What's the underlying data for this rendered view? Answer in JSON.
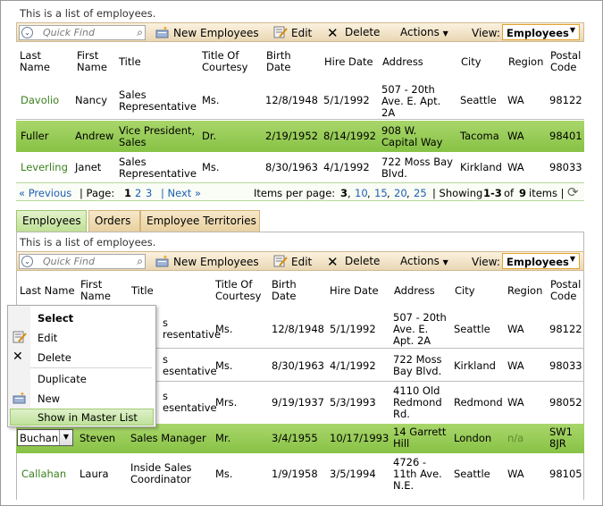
{
  "description": "This is a list of employees.",
  "toolbar": {
    "quick_find_placeholder": "Quick Find",
    "new_label": "New Employees",
    "edit_label": "Edit",
    "delete_label": "Delete",
    "actions_label": "Actions",
    "view_label": "View:",
    "view_value": "Employees"
  },
  "headers": {
    "last_name": [
      "Last",
      "Name"
    ],
    "first_name": [
      "First",
      "Name"
    ],
    "title": "Title",
    "title_of_courtesy": [
      "Title Of",
      "Courtesy"
    ],
    "birth_date": [
      "Birth",
      "Date"
    ],
    "hire_date": "Hire Date",
    "address": "Address",
    "city": "City",
    "region": "Region",
    "postal_code": [
      "Postal",
      "Code"
    ]
  },
  "master_rows": [
    {
      "last": "Davolio",
      "first": "Nancy",
      "title": [
        "Sales",
        "Representative"
      ],
      "courtesy": "Ms.",
      "birth": "12/8/1948",
      "hire": "5/1/1992",
      "address": [
        "507 - 20th",
        "Ave. E. Apt.",
        "2A"
      ],
      "city": "Seattle",
      "region": "WA",
      "postal": "98122"
    },
    {
      "last": "Fuller",
      "first": "Andrew",
      "title": [
        "Vice President,",
        "Sales"
      ],
      "courtesy": "Dr.",
      "birth": "2/19/1952",
      "hire": "8/14/1992",
      "address": [
        "908 W.",
        "Capital Way"
      ],
      "city": "Tacoma",
      "region": "WA",
      "postal": "98401",
      "selected": true
    },
    {
      "last": "Leverling",
      "first": "Janet",
      "title": [
        "Sales",
        "Representative"
      ],
      "courtesy": "Ms.",
      "birth": "8/30/1963",
      "hire": "4/1/1992",
      "address": [
        "722 Moss Bay",
        "Blvd."
      ],
      "city": "Kirkland",
      "region": "WA",
      "postal": "98033"
    }
  ],
  "pager": {
    "previous": "« Previous",
    "page_label": "| Page:",
    "pages": [
      "1",
      "2",
      "3"
    ],
    "next": "| Next »",
    "items_per_page_label": "Items per page:",
    "items_per_page": [
      "3",
      "10",
      "15",
      "20",
      "25"
    ],
    "showing_prefix": "| Showing",
    "showing_range": "1-3",
    "showing_of": "of",
    "showing_total": "9",
    "showing_suffix": "items |"
  },
  "tabs": [
    "Employees",
    "Orders",
    "Employee Territories"
  ],
  "detail_headers": {
    "last_name": "Last Name",
    "first_name": [
      "First",
      "Name"
    ],
    "title": "Title",
    "title_of_courtesy": [
      "Title Of",
      "Courtesy"
    ],
    "birth_date": [
      "Birth",
      "Date"
    ],
    "hire_date": "Hire Date",
    "address": "Address",
    "city": "City",
    "region": "Region",
    "postal_code": [
      "Postal",
      "Code"
    ]
  },
  "detail_rows": [
    {
      "title": [
        "s",
        "resentative"
      ],
      "courtesy": "Ms.",
      "birth": "12/8/1948",
      "hire": "5/1/1992",
      "address": [
        "507 - 20th",
        "Ave. E.",
        "Apt. 2A"
      ],
      "city": "Seattle",
      "region": "WA",
      "postal": "98122"
    },
    {
      "title": [
        "s",
        "esentative"
      ],
      "courtesy": "Ms.",
      "birth": "8/30/1963",
      "hire": "4/1/1992",
      "address": [
        "722 Moss",
        "Bay Blvd."
      ],
      "city": "Kirkland",
      "region": "WA",
      "postal": "98033"
    },
    {
      "title": [
        "s",
        "esentative"
      ],
      "courtesy": "Mrs.",
      "birth": "9/19/1937",
      "hire": "5/3/1993",
      "address": [
        "4110 Old",
        "Redmond",
        "Rd."
      ],
      "city": "Redmond",
      "region": "WA",
      "postal": "98052"
    },
    {
      "last": "Buchan",
      "first": "Steven",
      "title": [
        "Sales Manager"
      ],
      "courtesy": "Mr.",
      "birth": "3/4/1955",
      "hire": "10/17/1993",
      "address": [
        "14 Garrett",
        "Hill"
      ],
      "city": "London",
      "region": "n/a",
      "postal": [
        "SW1",
        "8JR"
      ],
      "selected": true
    },
    {
      "last": "Callahan",
      "first": "Laura",
      "title": [
        "Inside Sales",
        "Coordinator"
      ],
      "courtesy": "Ms.",
      "birth": "1/9/1958",
      "hire": "3/5/1994",
      "address": [
        "4726 -",
        "11th Ave.",
        "N.E."
      ],
      "city": "Seattle",
      "region": "WA",
      "postal": "98105"
    }
  ],
  "context_menu": {
    "select": "Select",
    "edit": "Edit",
    "delete": "Delete",
    "duplicate": "Duplicate",
    "new": "New",
    "show_in_master": "Show in Master List"
  },
  "colors": {
    "selected_row": "#87c245",
    "link": "#3b7f1c",
    "toolbar": "#e9d7b4"
  }
}
